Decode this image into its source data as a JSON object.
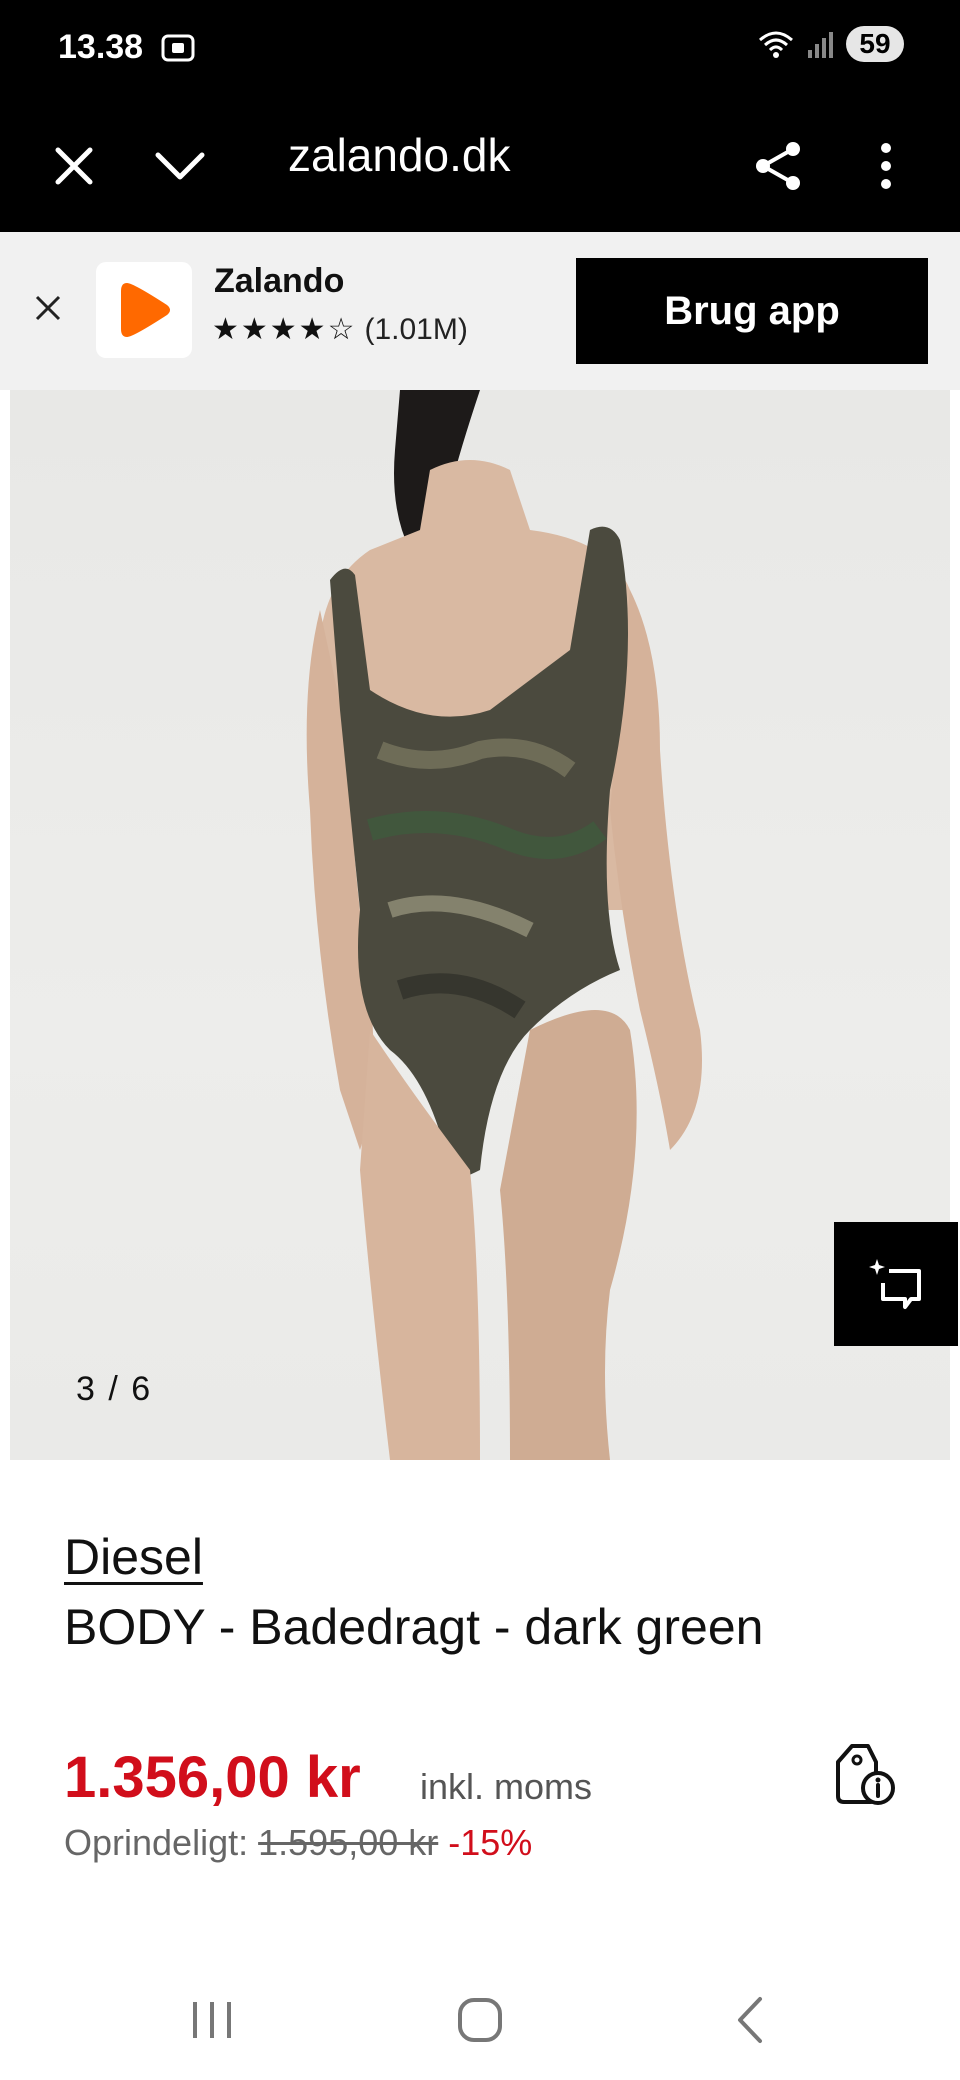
{
  "status": {
    "time": "13.38",
    "battery": "59"
  },
  "browser": {
    "url": "zalando.dk"
  },
  "banner": {
    "app_name": "Zalando",
    "stars": "★★★★☆",
    "rating_count": "(1.01M)",
    "cta": "Brug app",
    "accent": "#ff6900"
  },
  "gallery": {
    "counter": "3 / 6"
  },
  "product": {
    "brand": "Diesel",
    "title": "BODY - Badedragt - dark green",
    "price": "1.356,00 kr",
    "vat": "inkl. moms",
    "original_label": "Oprindeligt:",
    "original_price": "1.595,00 kr",
    "discount": "-15%",
    "price_color": "#d10e1b"
  },
  "icons": [
    "close-icon",
    "chevron-down-icon",
    "share-icon",
    "more-vert-icon",
    "ai-sparkle-icon",
    "price-info-icon",
    "recents-icon",
    "home-icon",
    "back-icon"
  ]
}
